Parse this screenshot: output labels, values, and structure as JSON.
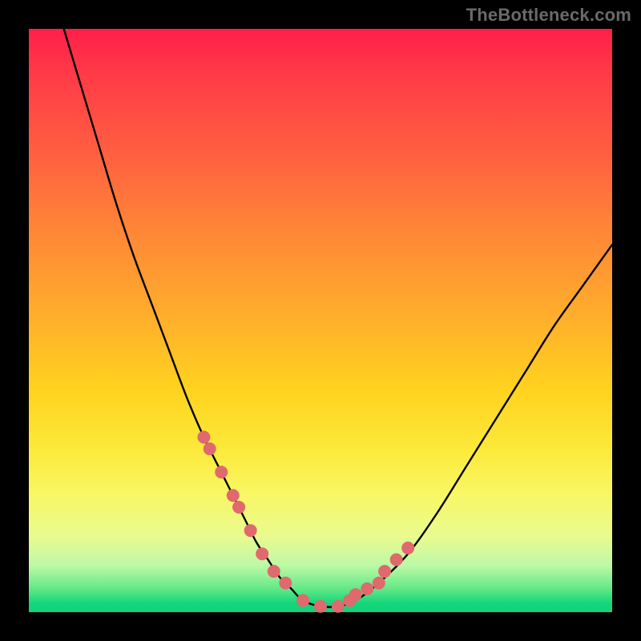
{
  "watermark": "TheBottleneck.com",
  "chart_data": {
    "type": "line",
    "title": "",
    "xlabel": "",
    "ylabel": "",
    "xlim": [
      0,
      100
    ],
    "ylim": [
      0,
      100
    ],
    "grid": false,
    "series": [
      {
        "name": "bottleneck-curve",
        "x": [
          6,
          9,
          12,
          15,
          18,
          21,
          24,
          27,
          30,
          33,
          35,
          37,
          39,
          41,
          43,
          45,
          47,
          50,
          53,
          56,
          60,
          65,
          70,
          75,
          80,
          85,
          90,
          95,
          100
        ],
        "y": [
          100,
          90,
          80,
          70,
          61,
          53,
          45,
          37,
          30,
          24,
          20,
          16,
          12,
          9,
          6,
          4,
          2,
          1,
          1,
          2,
          5,
          10,
          17,
          25,
          33,
          41,
          49,
          56,
          63
        ]
      }
    ],
    "markers": {
      "name": "sample-points",
      "color": "#e0696d",
      "radius_px": 8,
      "x": [
        30,
        31,
        33,
        35,
        36,
        38,
        40,
        42,
        44,
        47,
        50,
        53,
        55,
        56,
        58,
        60,
        61,
        63,
        65
      ],
      "y": [
        30,
        28,
        24,
        20,
        18,
        14,
        10,
        7,
        5,
        2,
        1,
        1,
        2,
        3,
        4,
        5,
        7,
        9,
        11
      ]
    }
  }
}
